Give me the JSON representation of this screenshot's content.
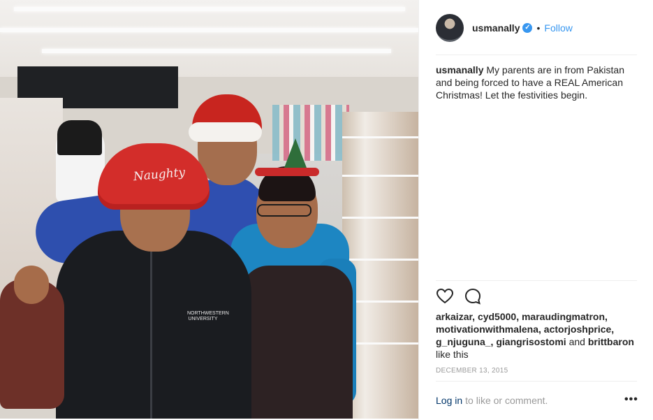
{
  "header": {
    "username": "usmanally",
    "separator": "•",
    "follow_label": "Follow"
  },
  "caption": {
    "username": "usmanally",
    "text": "My parents are in from Pakistan and being forced to have a REAL American Christmas! Let the festivities begin."
  },
  "photo": {
    "hat_text": "Naughty",
    "logo_line1": "NORTHWESTERN",
    "logo_line2": "UNIVERSITY"
  },
  "likes": {
    "names": "arkaizar, cyd5000, maraudingmatron, motivationwithmalena, actorjoshprice, g_njuguna_, giangrisostomi",
    "and_label": "and",
    "last_name": "brittbaron",
    "suffix": "like this"
  },
  "date": "DECEMBER 13, 2015",
  "comment": {
    "login_label": "Log in",
    "rest": "to like or comment.",
    "more_label": "•••"
  },
  "icons": [
    "heart-icon",
    "comment-icon",
    "verified-badge-icon",
    "more-options-icon"
  ],
  "colors": {
    "link": "#3897f0",
    "text": "#262626",
    "muted": "#999999",
    "login": "#003569"
  }
}
